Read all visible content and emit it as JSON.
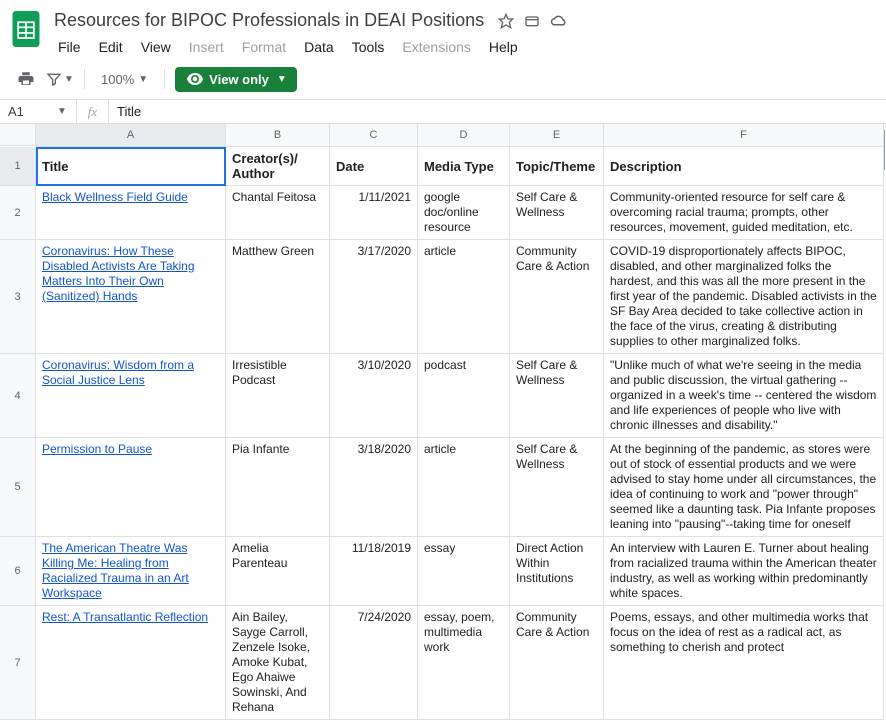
{
  "doc": {
    "title": "Resources for BIPOC Professionals in DEAI Positions"
  },
  "menubar": {
    "file": "File",
    "edit": "Edit",
    "view": "View",
    "insert": "Insert",
    "format": "Format",
    "data": "Data",
    "tools": "Tools",
    "extensions": "Extensions",
    "help": "Help"
  },
  "toolbar": {
    "zoom": "100%",
    "view_only": "View only"
  },
  "namebox": {
    "cell": "A1",
    "fx": "fx",
    "value": "Title"
  },
  "columns": {
    "A": "A",
    "B": "B",
    "C": "C",
    "D": "D",
    "E": "E",
    "F": "F"
  },
  "headers": {
    "title": "Title",
    "creator": "Creator(s)/ Author",
    "date": "Date",
    "media": "Media Type",
    "topic": "Topic/Theme",
    "description": "Description"
  },
  "row_nums": {
    "r1": "1",
    "r2": "2",
    "r3": "3",
    "r4": "4",
    "r5": "5",
    "r6": "6",
    "r7": "7"
  },
  "rows": {
    "r2": {
      "title": "Black Wellness Field Guide",
      "creator": "Chantal Feitosa",
      "date": "1/11/2021",
      "media": "google doc/online resource",
      "topic": "Self Care & Wellness",
      "description": "Community-oriented resource for self care & overcoming racial trauma; prompts, other resources, movement, guided meditation, etc."
    },
    "r3": {
      "title": "Coronavirus: How These Disabled Activists Are Taking Matters Into Their Own (Sanitized) Hands",
      "creator": "Matthew Green",
      "date": "3/17/2020",
      "media": "article",
      "topic": "Community Care & Action",
      "description": "COVID-19 disproportionately affects BIPOC, disabled, and other marginalized folks the hardest, and this was all the more present in the first year of the pandemic. Disabled activists in the SF Bay Area decided to take collective action in the face of the virus, creating & distributing supplies to other marginalized folks."
    },
    "r4": {
      "title": "Coronavirus: Wisdom from a Social Justice Lens",
      "creator": "Irresistible Podcast",
      "date": "3/10/2020",
      "media": "podcast",
      "topic": "Self Care & Wellness",
      "description": "\"Unlike much of what we're seeing in the media and public discussion, the virtual gathering -- organized in a week's time --  centered the wisdom and life experiences of people who live with chronic illnesses and disability.\""
    },
    "r5": {
      "title": "Permission to Pause",
      "creator": "Pia Infante",
      "date": "3/18/2020",
      "media": "article",
      "topic": "Self Care & Wellness",
      "description": "At the beginning of the pandemic, as stores were out of stock of essential products and we were advised to stay home under all circumstances, the idea of continuing to work and \"power through\" seemed like a daunting task. Pia Infante proposes leaning into \"pausing\"--taking time for oneself"
    },
    "r6": {
      "title": "The American Theatre Was Killing Me: Healing from Racialized Trauma in an Art Workspace",
      "creator": "Amelia Parenteau",
      "date": "11/18/2019",
      "media": "essay",
      "topic": "Direct Action Within Institutions",
      "description": "An interview with Lauren E. Turner about healing from racialized trauma within the American theater industry, as well as working within predominantly white spaces."
    },
    "r7": {
      "title": "Rest: A Transatlantic Reflection",
      "creator": "Ain Bailey, Sayge Carroll, Zenzele Isoke, Amoke Kubat, Ego Ahaiwe Sowinski, And Rehana",
      "date": "7/24/2020",
      "media": "essay, poem, multimedia work",
      "topic": "Community Care & Action",
      "description": "Poems, essays, and other multimedia works that focus on the idea of rest as a radical act, as something to cherish and protect"
    }
  }
}
